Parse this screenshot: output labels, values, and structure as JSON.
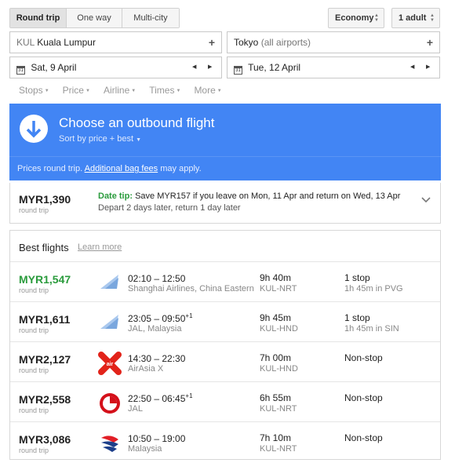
{
  "trip_types": [
    "Round trip",
    "One way",
    "Multi-city"
  ],
  "selected_trip_type": "Round trip",
  "cabin": "Economy",
  "passengers": "1 adult",
  "origin": {
    "code": "KUL",
    "name": "Kuala Lumpur"
  },
  "destination": {
    "name": "Tokyo",
    "detail": "(all airports)"
  },
  "depart_date": "Sat, 9 April",
  "return_date": "Tue, 12 April",
  "calendar_glyph": "31",
  "filters": [
    "Stops",
    "Price",
    "Airline",
    "Times",
    "More"
  ],
  "banner": {
    "title": "Choose an outbound flight",
    "sort_label": "Sort by price + best",
    "note_prefix": "Prices round trip.",
    "note_link": "Additional bag fees",
    "note_suffix": "may apply."
  },
  "date_tip": {
    "price": "MYR1,390",
    "price_note": "round trip",
    "label": "Date tip:",
    "text": "Save MYR157 if you leave on Mon, 11 Apr and return on Wed, 13 Apr",
    "detail": "Depart 2 days later, return 1 day later"
  },
  "best_flights": {
    "title": "Best flights",
    "learn_more": "Learn more",
    "flights": [
      {
        "price": "MYR1,547",
        "price_note": "round trip",
        "depart": "02:10",
        "arrive": "12:50",
        "arrive_sup": "",
        "airline": "Shanghai Airlines, China Eastern",
        "duration": "9h 40m",
        "route": "KUL-NRT",
        "stops": "1 stop",
        "stop_info": "1h 45m in PVG",
        "logo": "china-eastern-logo",
        "highlight": true
      },
      {
        "price": "MYR1,611",
        "price_note": "round trip",
        "depart": "23:05",
        "arrive": "09:50",
        "arrive_sup": "+1",
        "airline": "JAL, Malaysia",
        "duration": "9h 45m",
        "route": "KUL-HND",
        "stops": "1 stop",
        "stop_info": "1h 45m in SIN",
        "logo": "china-eastern-logo",
        "highlight": false
      },
      {
        "price": "MYR2,127",
        "price_note": "round trip",
        "depart": "14:30",
        "arrive": "22:30",
        "arrive_sup": "",
        "airline": "AirAsia X",
        "duration": "7h 00m",
        "route": "KUL-HND",
        "stops": "Non-stop",
        "stop_info": "",
        "logo": "airasia-logo",
        "highlight": false
      },
      {
        "price": "MYR2,558",
        "price_note": "round trip",
        "depart": "22:50",
        "arrive": "06:45",
        "arrive_sup": "+1",
        "airline": "JAL",
        "duration": "6h 55m",
        "route": "KUL-NRT",
        "stops": "Non-stop",
        "stop_info": "",
        "logo": "jal-logo",
        "highlight": false
      },
      {
        "price": "MYR3,086",
        "price_note": "round trip",
        "depart": "10:50",
        "arrive": "19:00",
        "arrive_sup": "",
        "airline": "Malaysia",
        "duration": "7h 10m",
        "route": "KUL-NRT",
        "stops": "Non-stop",
        "stop_info": "",
        "logo": "malaysia-airlines-logo",
        "highlight": false
      }
    ]
  },
  "colors": {
    "accent": "#4285f4",
    "price_highlight": "#2a9b3c",
    "stop_green": "#2a9b3c"
  }
}
